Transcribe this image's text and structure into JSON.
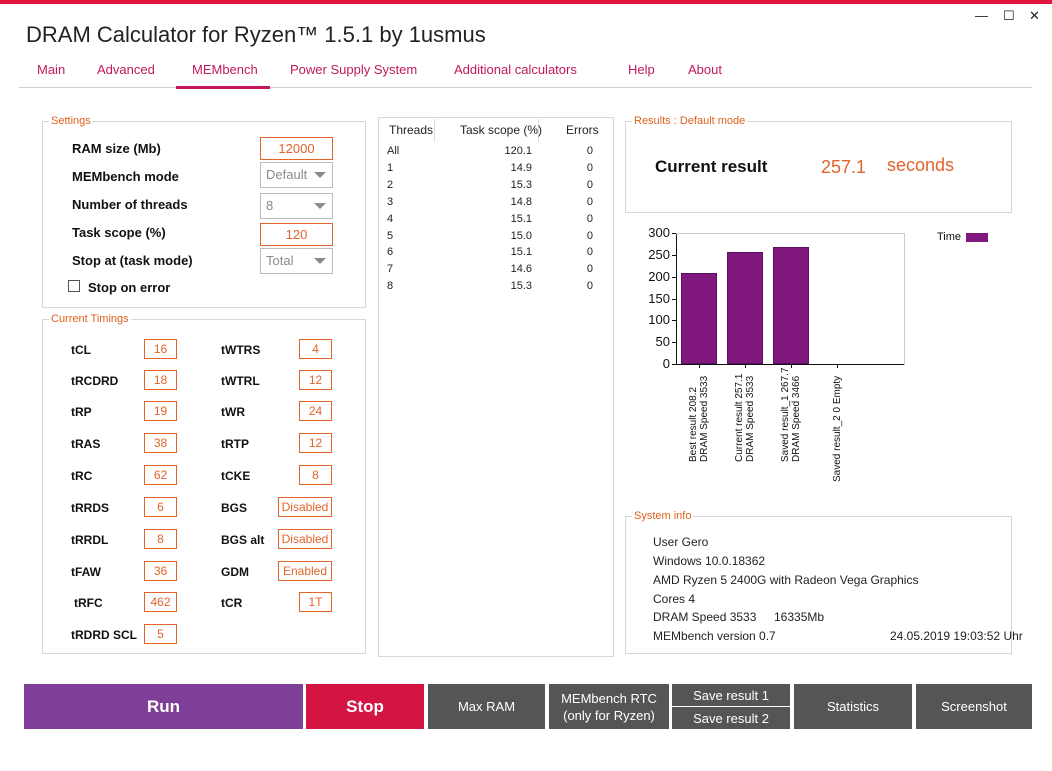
{
  "app": {
    "title": "DRAM Calculator for Ryzen™ 1.5.1 by 1usmus",
    "window_controls": {
      "minimize": "—",
      "maximize": "☐",
      "close": "✕"
    },
    "accent_color": "#e0163f",
    "tab_color": "#c2185b"
  },
  "tabs": [
    "Main",
    "Advanced",
    "MEMbench",
    "Power Supply System",
    "Additional calculators",
    "Help",
    "About"
  ],
  "active_tab": "MEMbench",
  "settings": {
    "legend": "Settings",
    "ram_size_label": "RAM size (Mb)",
    "ram_size_value": "12000",
    "mode_label": "MEMbench mode",
    "mode_value": "Default",
    "threads_label": "Number of threads",
    "threads_value": "8",
    "task_scope_label": "Task scope (%)",
    "task_scope_value": "120",
    "stop_at_label": "Stop at (task mode)",
    "stop_at_value": "Total",
    "stop_on_error_label": "Stop on error"
  },
  "timings": {
    "legend": "Current Timings",
    "left": [
      {
        "label": "tCL",
        "value": "16"
      },
      {
        "label": "tRCDRD",
        "value": "18"
      },
      {
        "label": "tRP",
        "value": "19"
      },
      {
        "label": "tRAS",
        "value": "38"
      },
      {
        "label": "tRC",
        "value": "62"
      },
      {
        "label": "tRRDS",
        "value": "6"
      },
      {
        "label": "tRRDL",
        "value": "8"
      },
      {
        "label": "tFAW",
        "value": "36"
      },
      {
        "label": "tRFC",
        "value": "462"
      },
      {
        "label": "tRDRD SCL",
        "value": "5"
      }
    ],
    "right": [
      {
        "label": "tWTRS",
        "value": "4"
      },
      {
        "label": "tWTRL",
        "value": "12"
      },
      {
        "label": "tWR",
        "value": "24"
      },
      {
        "label": "tRTP",
        "value": "12"
      },
      {
        "label": "tCKE",
        "value": "8"
      },
      {
        "label": "BGS",
        "value": "Disabled"
      },
      {
        "label": "BGS alt",
        "value": "Disabled"
      },
      {
        "label": "GDM",
        "value": "Enabled"
      },
      {
        "label": "tCR",
        "value": "1T"
      }
    ]
  },
  "threads_table": {
    "headers": [
      "Threads",
      "Task scope (%)",
      "Errors"
    ],
    "rows": [
      [
        "All",
        "120.1",
        "0"
      ],
      [
        "1",
        "14.9",
        "0"
      ],
      [
        "2",
        "15.3",
        "0"
      ],
      [
        "3",
        "14.8",
        "0"
      ],
      [
        "4",
        "15.1",
        "0"
      ],
      [
        "5",
        "15.0",
        "0"
      ],
      [
        "6",
        "15.1",
        "0"
      ],
      [
        "7",
        "14.6",
        "0"
      ],
      [
        "8",
        "15.3",
        "0"
      ]
    ]
  },
  "results": {
    "legend": "Results : Default mode",
    "label": "Current result",
    "value": "257.1",
    "unit": "seconds"
  },
  "chart_data": {
    "type": "bar",
    "categories": [
      [
        "Best result 208.2",
        "DRAM Speed 3533"
      ],
      [
        "Current result 257.1",
        "DRAM Speed 3533"
      ],
      [
        "Saved result_1 267.7",
        "DRAM Speed 3466"
      ],
      [
        "Saved result_2 0 Empty"
      ]
    ],
    "series": [
      {
        "name": "Time",
        "values": [
          208.2,
          257.1,
          267.7,
          0
        ]
      }
    ],
    "ylim": [
      0,
      300
    ],
    "yticks": [
      "300",
      "250",
      "200",
      "150",
      "100",
      "50",
      "0"
    ],
    "legend_position": "top-right",
    "bar_color": "#80187f",
    "grid": false
  },
  "system_info": {
    "legend": "System info",
    "user": "User Gero",
    "os": "Windows 10.0.18362",
    "cpu": "AMD Ryzen 5 2400G with Radeon Vega Graphics",
    "cores": "Cores 4",
    "dram_speed": "DRAM Speed 3533",
    "mem_size": "16335Mb",
    "membench_version": "MEMbench version 0.7",
    "timestamp": "24.05.2019 19:03:52 Uhr"
  },
  "buttons": {
    "run": "Run",
    "stop": "Stop",
    "max_ram": "Max RAM",
    "rtc_line1": "MEMbench RTC",
    "rtc_line2": "(only for Ryzen)",
    "save1": "Save result 1",
    "save2": "Save result 2",
    "statistics": "Statistics",
    "screenshot": "Screenshot",
    "colors": {
      "run": "#7f3f98",
      "stop": "#d41443",
      "gray": "#555555"
    }
  }
}
